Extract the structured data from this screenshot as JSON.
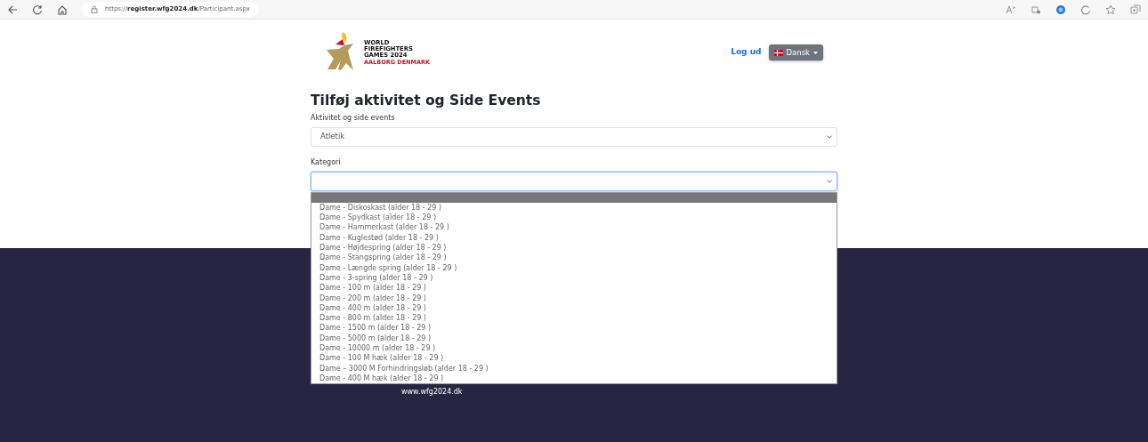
{
  "browser": {
    "url": "https://**register.wfg2024.dk**/Participant.aspx"
  },
  "header": {
    "logo_lines": [
      "WORLD",
      "FIREFIGHTERS",
      "GAMES 2024"
    ],
    "logo_tagline": "AALBORG DENMARK",
    "logout": "Log ud",
    "language": "Dansk"
  },
  "form": {
    "title": "Tilføj aktivitet og Side Events",
    "activity_label": "Aktivitet og side events",
    "activity_value": "Atletik",
    "category_label": "Kategori",
    "category_options": [
      {
        "selected": true
      },
      {
        "label": "Dame - Diskoskast (alder 18 - 29 )",
        "selected": false
      },
      {
        "label": "Dame - Spydkast (alder 18 - 29 )",
        "selected": false
      },
      {
        "label": "Dame - Hammerkast (alder 18 - 29 )",
        "selected": false
      },
      {
        "label": "Dame - Kuglestød (alder 18 - 29 )",
        "selected": false
      },
      {
        "label": "Dame - Højdespring (alder 18 - 29 )",
        "selected": false
      },
      {
        "label": "Dame - Stangspring (alder 18 - 29 )",
        "selected": false
      },
      {
        "label": "Dame - Længde spring (alder 18 - 29 )",
        "selected": false
      },
      {
        "label": "Dame - 3-spring (alder 18 - 29 )",
        "selected": false
      },
      {
        "label": "Dame - 100 m (alder 18 - 29 )",
        "selected": false
      },
      {
        "label": "Dame - 200 m (alder 18 - 29 )",
        "selected": false
      },
      {
        "label": "Dame - 400 m (alder 18 - 29 )",
        "selected": false
      },
      {
        "label": "Dame - 800 m (alder 18 - 29 )",
        "selected": false
      },
      {
        "label": "Dame - 1500 m (alder 18 - 29 )",
        "selected": false
      },
      {
        "label": "Dame - 5000 m (alder 18 - 29 )",
        "selected": false
      },
      {
        "label": "Dame - 10000 m (alder 18 - 29 )",
        "selected": false
      },
      {
        "label": "Dame - 100 M hæk (alder 18 - 29 )",
        "selected": false
      },
      {
        "label": "Dame – 3000 M Forhindringsløb (alder 18 - 29 )",
        "selected": false
      },
      {
        "label": "Dame - 400 M hæk (alder 18 - 29 )",
        "selected": false
      }
    ]
  },
  "footer": {
    "lines": [
      "www.wfg2024.dk"
    ]
  }
}
